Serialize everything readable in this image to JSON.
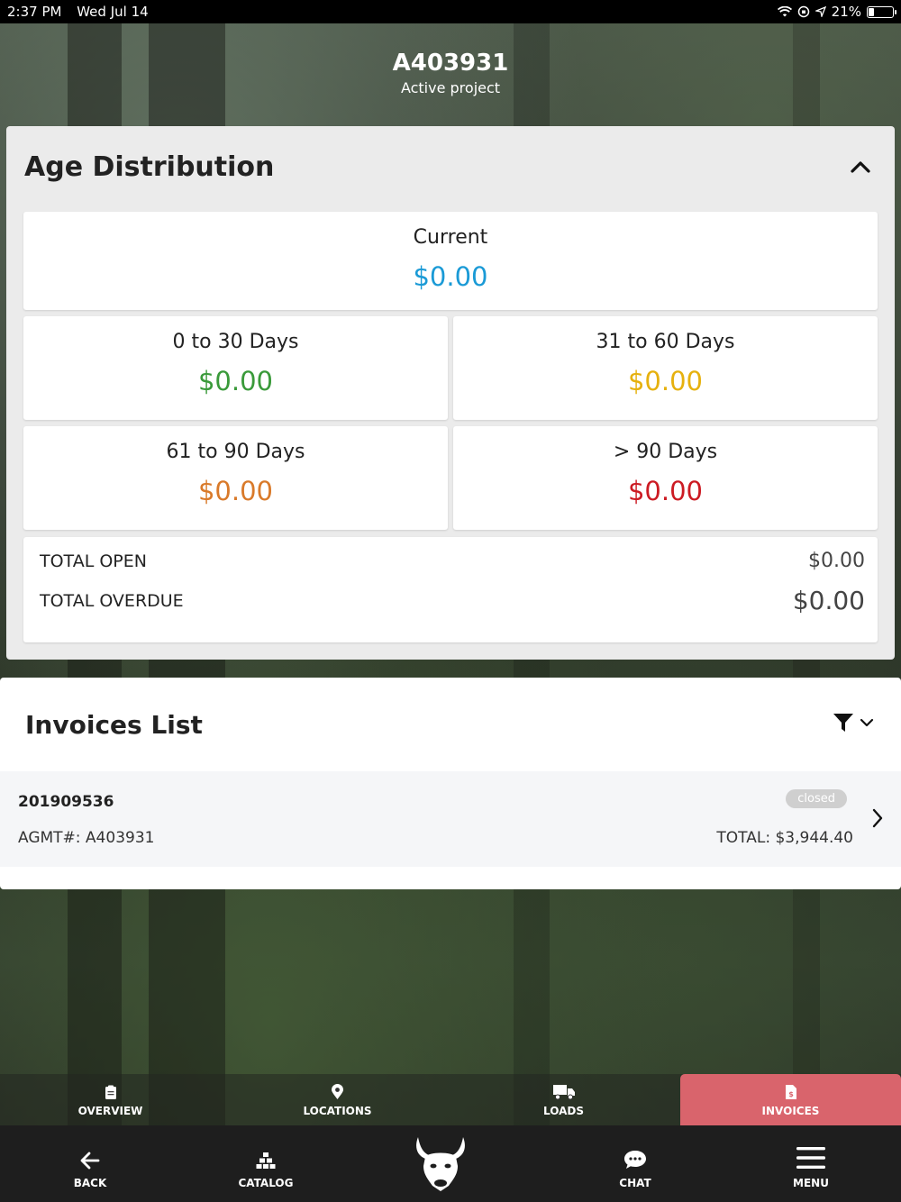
{
  "status_bar": {
    "time": "2:37 PM",
    "date": "Wed Jul 14",
    "battery": "21%"
  },
  "project": {
    "id": "A403931",
    "subtitle": "Active project"
  },
  "age_distribution": {
    "title": "Age Distribution",
    "current": {
      "label": "Current",
      "amount": "$0.00",
      "color": "#1a9ad6"
    },
    "buckets": [
      {
        "label": "0 to 30 Days",
        "amount": "$0.00",
        "color": "#3a9a3a"
      },
      {
        "label": "31 to 60 Days",
        "amount": "$0.00",
        "color": "#e6b10e"
      },
      {
        "label": "61 to 90 Days",
        "amount": "$0.00",
        "color": "#d97a2a"
      },
      {
        "label": "> 90 Days",
        "amount": "$0.00",
        "color": "#cc1b23"
      }
    ],
    "totals": {
      "open_label": "TOTAL OPEN",
      "open_value": "$0.00",
      "overdue_label": "TOTAL OVERDUE",
      "overdue_value": "$0.00"
    }
  },
  "invoices": {
    "title": "Invoices List",
    "items": [
      {
        "number": "201909536",
        "agmt": "AGMT#:  A403931",
        "status": "closed",
        "total": "TOTAL:  $3,944.40"
      }
    ]
  },
  "tabs": [
    {
      "label": "OVERVIEW",
      "icon": "clipboard-icon"
    },
    {
      "label": "LOCATIONS",
      "icon": "map-pin-icon"
    },
    {
      "label": "LOADS",
      "icon": "truck-icon"
    },
    {
      "label": "INVOICES",
      "icon": "invoice-icon",
      "active": true
    }
  ],
  "bottom_nav": {
    "back": "BACK",
    "catalog": "CATALOG",
    "chat": "CHAT",
    "menu": "MENU"
  },
  "accent_color": "#d9646c"
}
